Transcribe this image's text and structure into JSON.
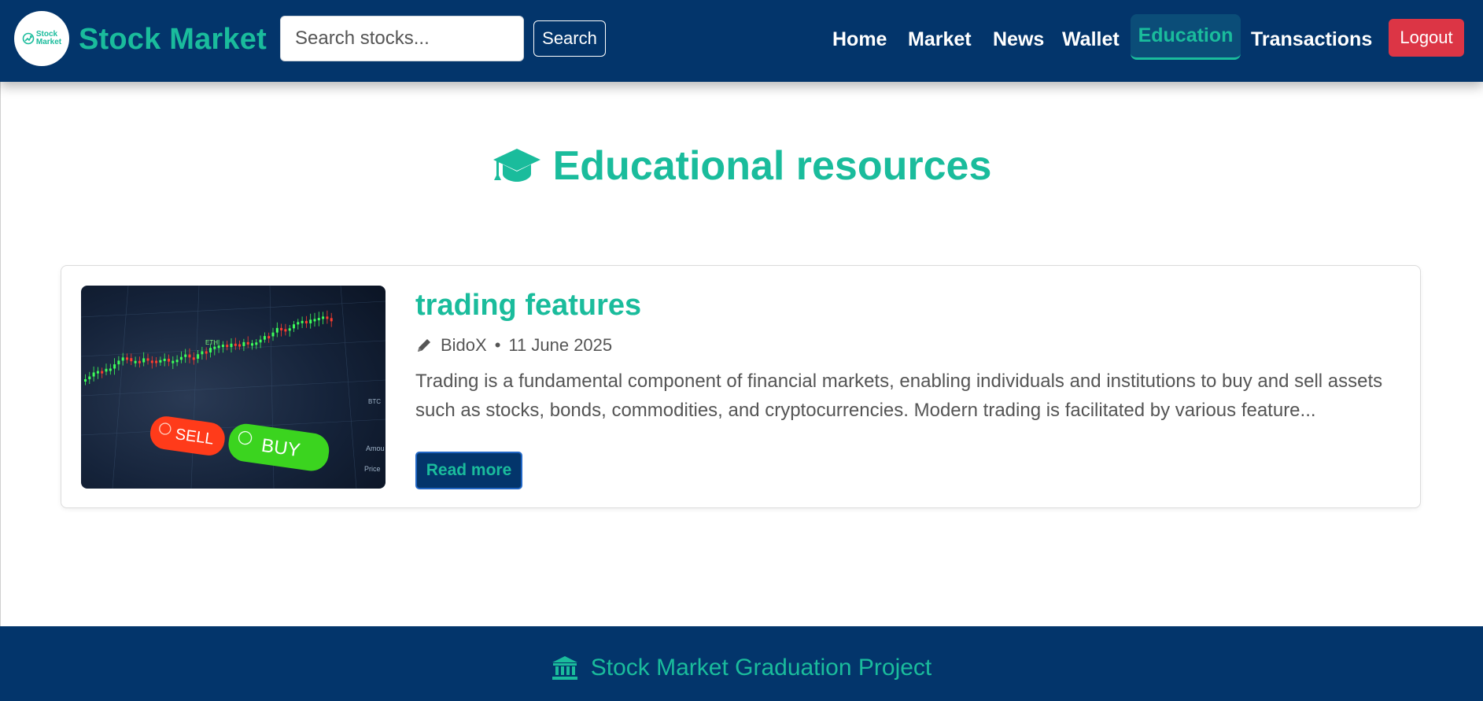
{
  "brand": {
    "logo_text_line1": "Stock",
    "logo_text_line2": "Market",
    "name": "Stock Market"
  },
  "search": {
    "placeholder": "Search stocks...",
    "button_label": "Search"
  },
  "nav": {
    "items": [
      {
        "label": "Home"
      },
      {
        "label": "Market"
      },
      {
        "label": "News"
      },
      {
        "label": "Wallet"
      },
      {
        "label": "Education",
        "active": true
      },
      {
        "label": "Transactions"
      }
    ],
    "logout_label": "Logout"
  },
  "page": {
    "title": "Educational resources",
    "title_icon": "graduation-cap-icon"
  },
  "articles": [
    {
      "title": "trading features",
      "author": "BidoX",
      "date": "11 June 2025",
      "meta_separator": "•",
      "excerpt": "Trading is a fundamental component of financial markets, enabling individuals and institutions to buy and sell assets such as stocks, bonds, commodities, and cryptocurrencies. Modern trading is facilitated by various feature...",
      "read_more_label": "Read more",
      "image": {
        "sell_label": "SELL",
        "buy_label": "BUY",
        "eth_label": "ETH",
        "side_label_1": "Amou",
        "side_label_2": "Price",
        "side_label_3": "BTC"
      }
    }
  ],
  "footer": {
    "title": "Stock Market Graduation Project",
    "icon": "bank-icon"
  },
  "colors": {
    "navbar_bg": "#03356b",
    "accent": "#1abc9c",
    "danger": "#dc3545",
    "text_muted": "#555555"
  }
}
